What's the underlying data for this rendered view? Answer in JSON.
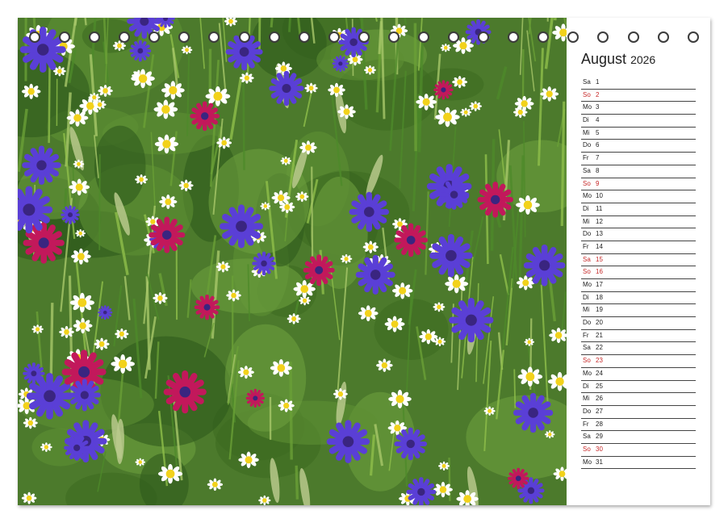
{
  "calendar": {
    "month": "August",
    "year": "2026",
    "days": [
      {
        "dn": "Sa",
        "num": "1",
        "red": false
      },
      {
        "dn": "So",
        "num": "2",
        "red": true
      },
      {
        "dn": "Mo",
        "num": "3",
        "red": false
      },
      {
        "dn": "Di",
        "num": "4",
        "red": false
      },
      {
        "dn": "Mi",
        "num": "5",
        "red": false
      },
      {
        "dn": "Do",
        "num": "6",
        "red": false
      },
      {
        "dn": "Fr",
        "num": "7",
        "red": false
      },
      {
        "dn": "Sa",
        "num": "8",
        "red": false
      },
      {
        "dn": "So",
        "num": "9",
        "red": true
      },
      {
        "dn": "Mo",
        "num": "10",
        "red": false
      },
      {
        "dn": "Di",
        "num": "11",
        "red": false
      },
      {
        "dn": "Mi",
        "num": "12",
        "red": false
      },
      {
        "dn": "Do",
        "num": "13",
        "red": false
      },
      {
        "dn": "Fr",
        "num": "14",
        "red": false
      },
      {
        "dn": "Sa",
        "num": "15",
        "red": true
      },
      {
        "dn": "So",
        "num": "16",
        "red": true
      },
      {
        "dn": "Mo",
        "num": "17",
        "red": false
      },
      {
        "dn": "Di",
        "num": "18",
        "red": false
      },
      {
        "dn": "Mi",
        "num": "19",
        "red": false
      },
      {
        "dn": "Do",
        "num": "20",
        "red": false
      },
      {
        "dn": "Fr",
        "num": "21",
        "red": false
      },
      {
        "dn": "Sa",
        "num": "22",
        "red": false
      },
      {
        "dn": "So",
        "num": "23",
        "red": true
      },
      {
        "dn": "Mo",
        "num": "24",
        "red": false
      },
      {
        "dn": "Di",
        "num": "25",
        "red": false
      },
      {
        "dn": "Mi",
        "num": "26",
        "red": false
      },
      {
        "dn": "Do",
        "num": "27",
        "red": false
      },
      {
        "dn": "Fr",
        "num": "28",
        "red": false
      },
      {
        "dn": "Sa",
        "num": "29",
        "red": false
      },
      {
        "dn": "So",
        "num": "30",
        "red": true
      },
      {
        "dn": "Mo",
        "num": "31",
        "red": false
      }
    ]
  },
  "colors": {
    "holiday": "#c62828",
    "text": "#222222",
    "meadow": "#4c7a2c",
    "cornflower": "#5a3fd6",
    "daisy_petal": "#ffffff",
    "daisy_center": "#f2d21b"
  },
  "photo": {
    "subject_icons": [
      "wildflower-meadow-photo"
    ]
  }
}
